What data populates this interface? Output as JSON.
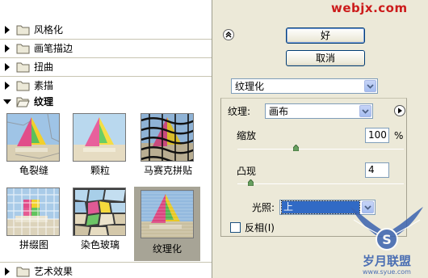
{
  "watermark": {
    "site": "webjx.com",
    "brand": "岁月联盟",
    "brand_url": "www.syue.com"
  },
  "categories_top": [
    {
      "label": "风格化",
      "open": false
    },
    {
      "label": "画笔描边",
      "open": false
    },
    {
      "label": "扭曲",
      "open": false
    },
    {
      "label": "素描",
      "open": false
    },
    {
      "label": "纹理",
      "open": true
    }
  ],
  "category_bottom": {
    "label": "艺术效果",
    "open": false
  },
  "thumbnails": [
    {
      "label": "龟裂缝",
      "selected": false
    },
    {
      "label": "颗粒",
      "selected": false
    },
    {
      "label": "马赛克拼贴",
      "selected": false
    },
    {
      "label": "拼缀图",
      "selected": false
    },
    {
      "label": "染色玻璃",
      "selected": false
    },
    {
      "label": "纹理化",
      "selected": true
    }
  ],
  "buttons": {
    "ok": "好",
    "cancel": "取消"
  },
  "filter_select": "纹理化",
  "texture": {
    "label": "纹理:",
    "value": "画布"
  },
  "scaling": {
    "label": "缩放",
    "value": "100",
    "unit": "%",
    "slider_fraction": 0.35
  },
  "relief": {
    "label": "凸现",
    "value": "4",
    "slider_fraction": 0.08
  },
  "light": {
    "label": "光照:",
    "value": "上"
  },
  "invert": {
    "label": "反相",
    "shortcut": "(I)",
    "checked": false
  },
  "colors": {
    "selection": "#316ac5",
    "watermark_red": "#cc1b1b",
    "logo_blue": "#3a62b0"
  }
}
